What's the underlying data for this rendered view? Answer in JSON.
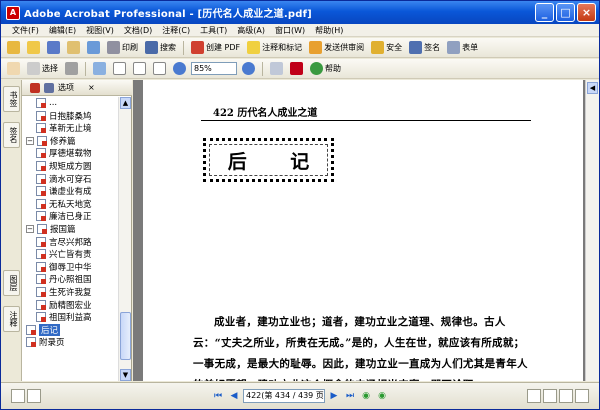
{
  "window": {
    "title": "Adobe Acrobat Professional - [历代名人成业之道.pdf]",
    "app_icon": "acrobat-icon",
    "controls": [
      "_",
      "□",
      "×"
    ]
  },
  "menu": [
    "文件(F)",
    "编辑(E)",
    "视图(V)",
    "文档(D)",
    "注释(C)",
    "工具(T)",
    "高级(A)",
    "窗口(W)",
    "帮助(H)"
  ],
  "toolbar1": {
    "print": "印刷",
    "search": "搜索",
    "create_pdf": "创建 PDF",
    "comment": "注释和标记",
    "review": "发送供审阅",
    "secure": "安全",
    "sign": "签名",
    "forms": "表单"
  },
  "toolbar2": {
    "select": "选择",
    "zoom": "85%",
    "help": "帮助"
  },
  "left_panel": {
    "vertical_tabs": [
      "书签",
      "签名",
      "图层",
      "注释"
    ],
    "options_label": "选项",
    "close": "×",
    "tree": [
      {
        "label": "...",
        "level": 1,
        "partial": true
      },
      {
        "label": "日抱膝桑鸠",
        "level": 1
      },
      {
        "label": "革新无止境",
        "level": 1
      },
      {
        "label": "修养篇",
        "level": 0,
        "expanded": true
      },
      {
        "label": "厚德堪载物",
        "level": 1
      },
      {
        "label": "规矩成方圆",
        "level": 1
      },
      {
        "label": "滴水可穿石",
        "level": 1
      },
      {
        "label": "谦虚业有成",
        "level": 1
      },
      {
        "label": "无私天地宽",
        "level": 1
      },
      {
        "label": "廉洁已身正",
        "level": 1
      },
      {
        "label": "报国篇",
        "level": 0,
        "expanded": true
      },
      {
        "label": "言尽兴邦路",
        "level": 1
      },
      {
        "label": "兴亡皆有责",
        "level": 1
      },
      {
        "label": "御辱卫中华",
        "level": 1
      },
      {
        "label": "丹心照祖国",
        "level": 1
      },
      {
        "label": "生死许我复",
        "level": 1
      },
      {
        "label": "励精图宏业",
        "level": 1
      },
      {
        "label": "祖国利益高",
        "level": 1
      },
      {
        "label": "后记",
        "level": 0,
        "selected": true
      },
      {
        "label": "附录页",
        "level": 0
      }
    ]
  },
  "document": {
    "running_head_page": "422",
    "running_head_title": "历代名人成业之道",
    "heading_left": "后",
    "heading_right": "记",
    "paragraph": "成业者，建功立业也；道者，建功立业之道理、规律也。古人云：“丈夫之所业，所贵在无成。”是的，人生在世，就应该有所成就；一事无成，是最大的耻辱。因此，建功立业一直成为人们尤其是青年人的美好愿望。建功立业这个概念的内涵相当丰富，即不论职"
  },
  "status": {
    "page_indicator": "422(第 434 / 439 页)"
  },
  "colors": {
    "titlebar": "#0a57d8",
    "chrome": "#ece9d8",
    "doc_bg": "#7a7a7a"
  }
}
